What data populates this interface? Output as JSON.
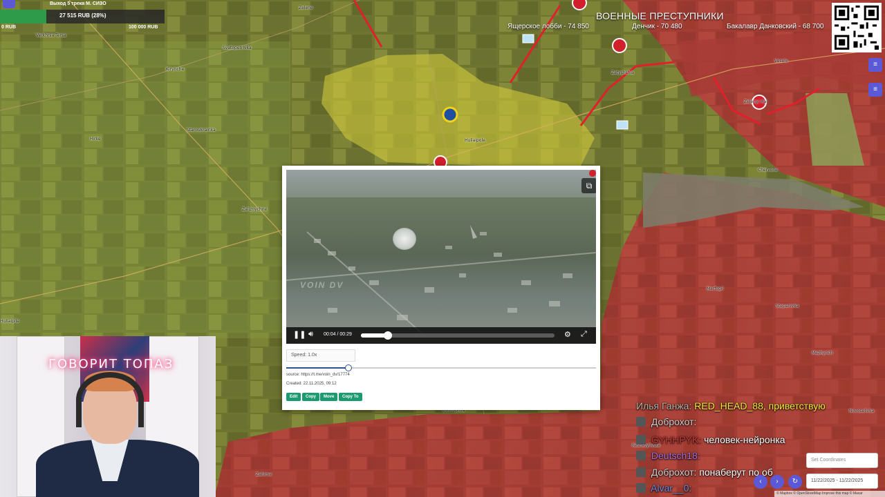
{
  "donation_goal": {
    "title": "Выход 5 трека М. СИЗО",
    "amount": "27 515 RUB (28%)",
    "progress_fraction": 0.28,
    "min_label": "0 RUB",
    "max_label": "100 000 RUB"
  },
  "shame_board": {
    "title": "ВОЕННЫЕ ПРЕСТУПНИКИ",
    "entries": [
      "Ящерское лобби - 74 850",
      "Денчик - 70 480",
      "Бакалавр Данковский - 68 700"
    ]
  },
  "map": {
    "places": [
      "Zelene",
      "Verkhnia Tersa",
      "Svatopetrivka",
      "Kirynche",
      "Staroukrainka",
      "Hirke",
      "Zaliznychne",
      "Huliaipile",
      "Huliaipole",
      "Zatyshshia",
      "Vesele",
      "Zelenyi Hai",
      "Chervone",
      "Marfopil",
      "Stepanivka",
      "Mezhyrich",
      "Novoselivka",
      "Dobropillia",
      "Zahirne",
      "Reshetylivske"
    ],
    "colors": {
      "ukraine_control": "#cfcf3a",
      "russia_control": "#b83a3a",
      "contested": "#8a8a7a",
      "attack_arrow": "#e0202a"
    }
  },
  "video_player": {
    "current_time": "00:04",
    "duration": "00:29",
    "time_display": "00:04 / 00:29",
    "progress_fraction": 0.138,
    "buffered_fraction": 0.16,
    "watermark": "VOIN DV",
    "play_icon": "pause-icon",
    "volume_icon": "volume-icon",
    "settings_icon": "gear-icon",
    "fullscreen_icon": "fullscreen-icon",
    "pip_icon": "picture-in-picture-icon"
  },
  "video_meta": {
    "speed_label": "Speed: 1.0x",
    "speed_fraction": 0.2,
    "source": "source: https://t.me/voin_dv/17774",
    "created": "Created: 22.11.2025, 09:12",
    "buttons": [
      "Edit",
      "Copy",
      "Move",
      "Copy To"
    ]
  },
  "webcam": {
    "neon_sign": "ГОВОРИТ ТОПАЗ"
  },
  "chat": [
    {
      "user": "Илья Ганжа:",
      "user_color": "#b5b1a6",
      "msg": "RED_HEAD_88, приветствую",
      "msg_color": "#f0ec3c"
    },
    {
      "user": "Доброхот:",
      "user_color": "#cfcfcf",
      "msg": "",
      "msg_color": "#ffffff"
    },
    {
      "user": "GYHHPYK:",
      "user_color": "#c43a3a",
      "msg": "человек-нейронка",
      "msg_color": "#ffffff"
    },
    {
      "user": "Deutsch18:",
      "user_color": "#a66fd6",
      "msg": "",
      "msg_color": "#ffffff"
    },
    {
      "user": "Доброхот:",
      "user_color": "#cfcfcf",
      "msg": "понаберут по об",
      "msg_color": "#ffffff"
    },
    {
      "user": "Alvar__0:",
      "user_color": "#6e8bd6",
      "msg": "",
      "msg_color": "#ffffff"
    }
  ],
  "map_widgets": {
    "coords_placeholder": "Set Coordinates",
    "date_range": "11/22/2025 - 11/22/2025",
    "attribution": "© Mapbox © OpenStreetMap Improve this map © Maxar"
  }
}
